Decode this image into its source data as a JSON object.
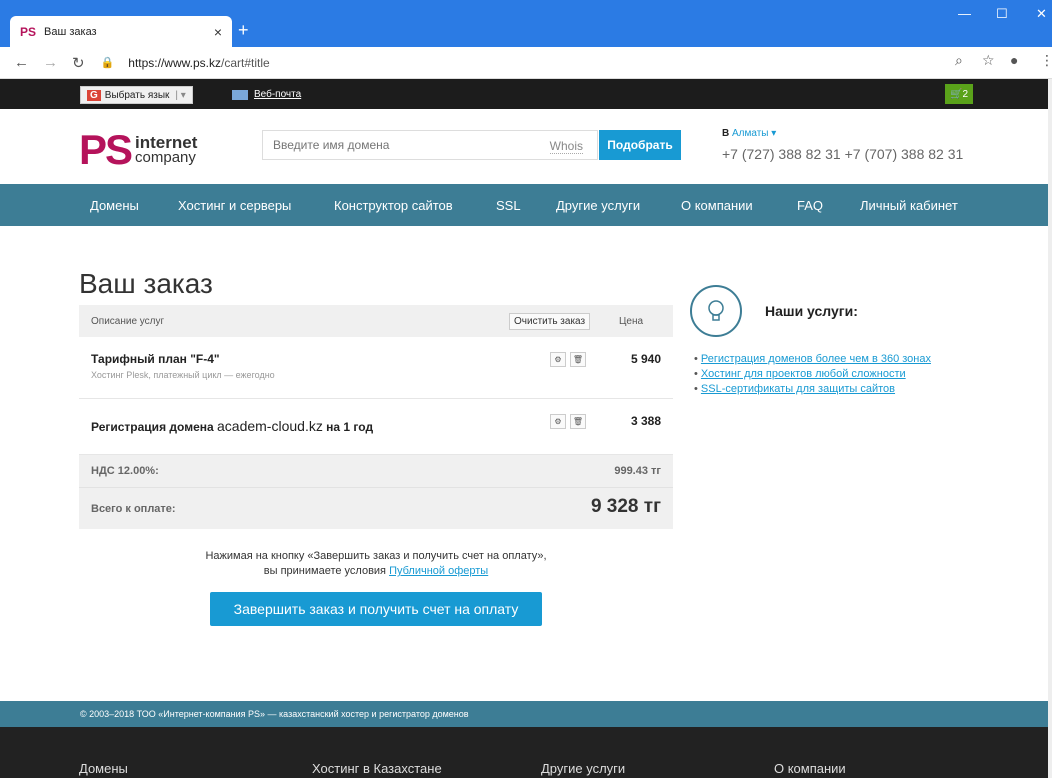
{
  "browser": {
    "tab_favicon": "PS",
    "tab_title": "Ваш заказ",
    "tab_close": "×",
    "new_tab": "+",
    "url_host": "https://www.ps.kz",
    "url_path": "/cart#title"
  },
  "topbar": {
    "lang_label": "Выбрать язык",
    "lang_g": "G",
    "webmail": "Веб-почта",
    "cart_count": "2"
  },
  "header": {
    "logo_ps": "PS",
    "logo_line1": "internet",
    "logo_line2": "company",
    "domain_placeholder": "Введите имя домена",
    "whois": "Whois",
    "pick_button": "Подобрать",
    "city_prefix": "В ",
    "city": "Алматы ▾",
    "phones": "+7 (727) 388 82 31 +7 (707) 388 82 31"
  },
  "menu": [
    "Домены",
    "Хостинг и серверы",
    "Конструктор сайтов",
    "SSL",
    "Другие услуги",
    "О компании",
    "FAQ",
    "Личный кабинет"
  ],
  "order": {
    "title": "Ваш заказ",
    "col_desc": "Описание услуг",
    "clear_button": "Очистить заказ",
    "col_price": "Цена",
    "items": [
      {
        "title": "Тарифный план \"F-4\"",
        "sub": "Хостинг Plesk, платежный цикл — ежегодно",
        "price": "5 940"
      },
      {
        "title_pre": "Регистрация домена ",
        "domain": "academ-cloud.kz",
        "title_post": " на 1 год",
        "price": "3 388"
      }
    ],
    "vat_label": "НДС 12.00%:",
    "vat_value": "999.43 тг",
    "total_label": "Всего к оплате:",
    "total_value": "9 328 тг",
    "note_line1": "Нажимая на кнопку «Завершить заказ и получить счет на оплату»,",
    "note_line2": "вы принимаете условия ",
    "note_link": "Публичной оферты",
    "finish_button": "Завершить заказ и получить счет на оплату"
  },
  "services": {
    "title": "Наши услуги:",
    "links": [
      "Регистрация доменов более чем в 360 зонах",
      "Хостинг для проектов любой сложности",
      "SSL-сертификаты для защиты сайтов"
    ]
  },
  "footer": {
    "copyright": "© 2003–2018 ТОО «Интернет-компания PS» — казахстанский хостер и регистратор доменов",
    "cols": [
      "Домены",
      "Хостинг в Казахстане",
      "Другие услуги",
      "О компании"
    ]
  },
  "colors": {
    "brand": "#b5135b",
    "accent": "#189ad3",
    "menu": "#3d7d95",
    "cart": "#5aa21a"
  }
}
